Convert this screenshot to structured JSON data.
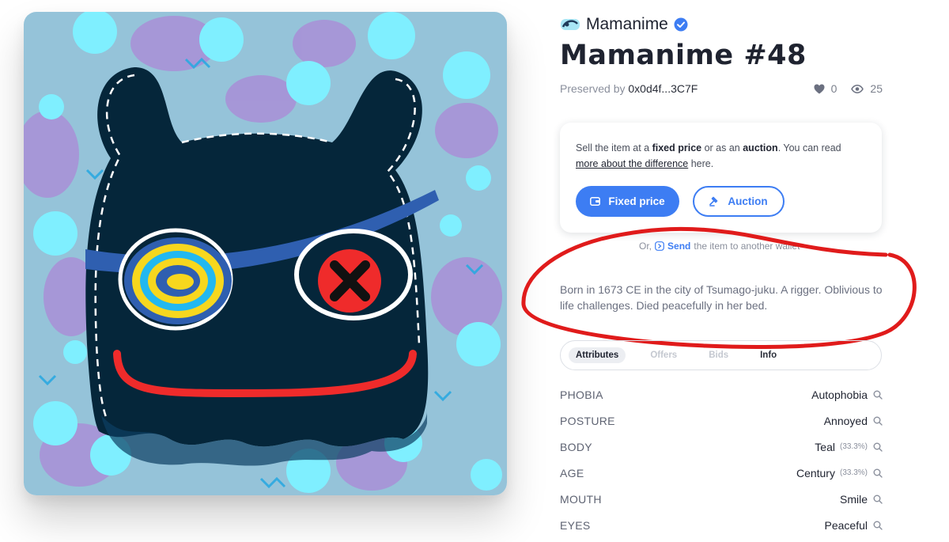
{
  "collection": {
    "name": "Mamanime",
    "logo_icon": "collection-logo-icon",
    "verified_icon": "verified-check-icon"
  },
  "item": {
    "title": "Mamanime #48"
  },
  "owner": {
    "prefix": "Preserved by",
    "address": "0x0d4f...3C7F"
  },
  "stats": {
    "likes": "0",
    "views": "25"
  },
  "sell": {
    "text_1": "Sell the item at a ",
    "fixed_price_bold": "fixed price",
    "text_2": " or as an ",
    "auction_bold": "auction",
    "text_3": ". You can read ",
    "link_text": "more about the difference",
    "text_4": " here.",
    "fixed_price_button": "Fixed price",
    "auction_button": "Auction"
  },
  "send": {
    "prefix": "Or,",
    "link": "Send",
    "suffix": "the item to another wallet"
  },
  "description": "Born in 1673 CE in the city of Tsumago-juku. A rigger. Oblivious to life challenges. Died peacefully in her bed.",
  "tabs": [
    {
      "label": "Attributes"
    },
    {
      "label": "Offers"
    },
    {
      "label": "Bids"
    },
    {
      "label": "Info"
    }
  ],
  "attributes": [
    {
      "key": "PHOBIA",
      "value": "Autophobia",
      "pct": ""
    },
    {
      "key": "POSTURE",
      "value": "Annoyed",
      "pct": ""
    },
    {
      "key": "BODY",
      "value": "Teal",
      "pct": "(33.3%)"
    },
    {
      "key": "AGE",
      "value": "Century",
      "pct": "(33.3%)"
    },
    {
      "key": "MOUTH",
      "value": "Smile",
      "pct": ""
    },
    {
      "key": "EYES",
      "value": "Peaceful",
      "pct": ""
    }
  ],
  "colors": {
    "accent": "#3d7df3",
    "art_background": "#95c3d9",
    "character": "#05263a",
    "annotation_red": "#e01b1b"
  }
}
